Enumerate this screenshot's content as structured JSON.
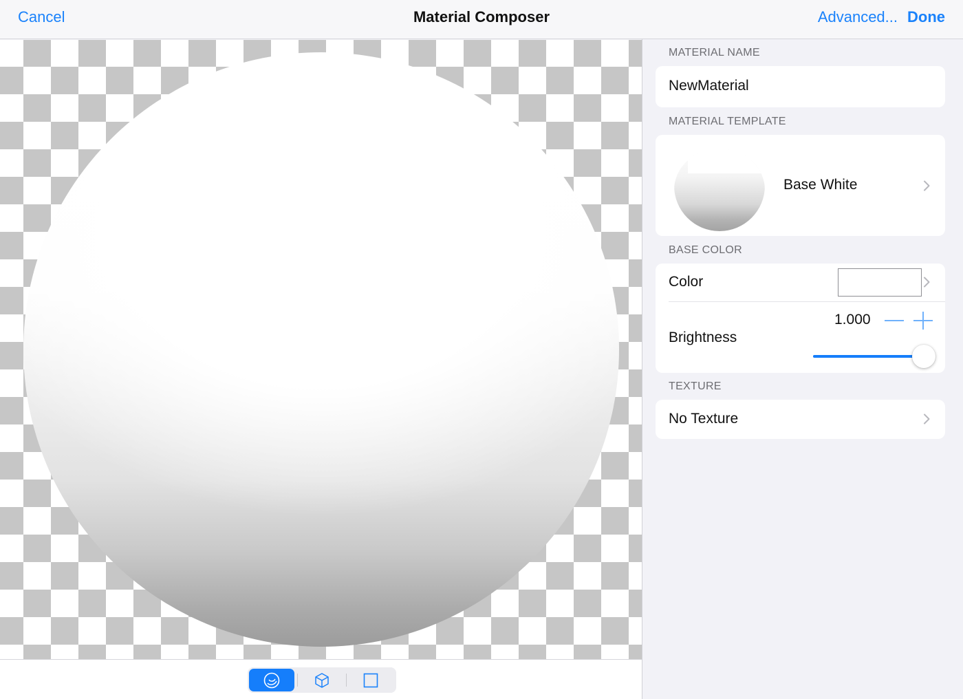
{
  "navbar": {
    "cancel_label": "Cancel",
    "title": "Material Composer",
    "advanced_label": "Advanced...",
    "done_label": "Done"
  },
  "preview": {
    "modes": [
      {
        "icon": "sphere-icon",
        "selected": true
      },
      {
        "icon": "cube-icon",
        "selected": false
      },
      {
        "icon": "plane-icon",
        "selected": false
      }
    ]
  },
  "panel": {
    "material_name_header": "MATERIAL NAME",
    "material_name_value": "NewMaterial",
    "material_template_header": "MATERIAL TEMPLATE",
    "template_name": "Base White",
    "base_color_header": "BASE COLOR",
    "color_label": "Color",
    "color_value": "#ffffff",
    "brightness_label": "Brightness",
    "brightness_value": "1.000",
    "brightness_fraction": 1.0,
    "texture_header": "TEXTURE",
    "texture_value": "No Texture"
  },
  "colors": {
    "accent": "#157efb",
    "link": "#1a82fb",
    "panel_background": "#f2f2f7"
  }
}
